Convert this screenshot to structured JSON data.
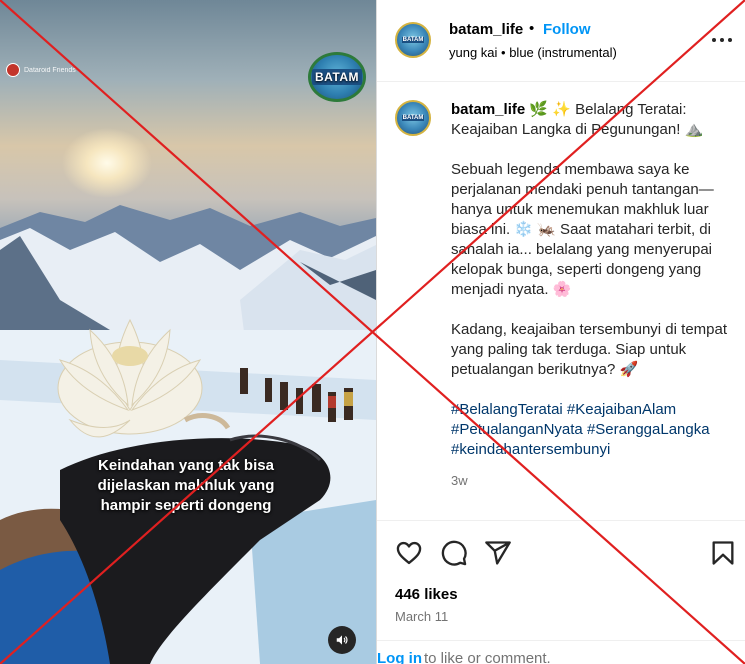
{
  "video": {
    "watermark_text": "Dataroid Friends",
    "logo_text": "BATAM",
    "caption_overlay": "Keindahan yang tak bisa dijelaskan makhluk yang hampir seperti dongeng",
    "sound_icon": "volume-icon"
  },
  "header": {
    "username": "batam_life",
    "separator": "•",
    "follow_label": "Follow",
    "audio": "yung kai • blue (instrumental)",
    "avatar_text": "BATAM"
  },
  "caption": {
    "username": "batam_life",
    "title": "🌿 ✨ Belalang Teratai: Keajaiban Langka di Pegunungan! ⛰️",
    "para1": "Sebuah legenda membawa saya ke perjalanan mendaki penuh tantangan—hanya untuk menemukan makhluk luar biasa ini. ❄️ 🦗 Saat matahari terbit, di sanalah ia... belalang yang menyerupai kelopak bunga, seperti dongeng yang menjadi nyata. 🌸",
    "para2": "Kadang, keajaiban tersembunyi di tempat yang paling tak terduga. Siap untuk petualangan berikutnya? 🚀",
    "hashtags": [
      "#BelalangTeratai",
      "#KeajaibanAlam",
      "#PetualanganNyata",
      "#SeranggaLangka",
      "#keindahantersembunyi"
    ],
    "time": "3w"
  },
  "actions": {
    "like_icon": "heart-icon",
    "comment_icon": "comment-icon",
    "share_icon": "share-icon",
    "save_icon": "bookmark-icon"
  },
  "stats": {
    "likes": "446 likes",
    "date": "March 11"
  },
  "login": {
    "link": "Log in",
    "rest": "to like or comment."
  },
  "colors": {
    "link_blue": "#0095f6",
    "hashtag": "#00376b",
    "cross": "#e02020"
  }
}
